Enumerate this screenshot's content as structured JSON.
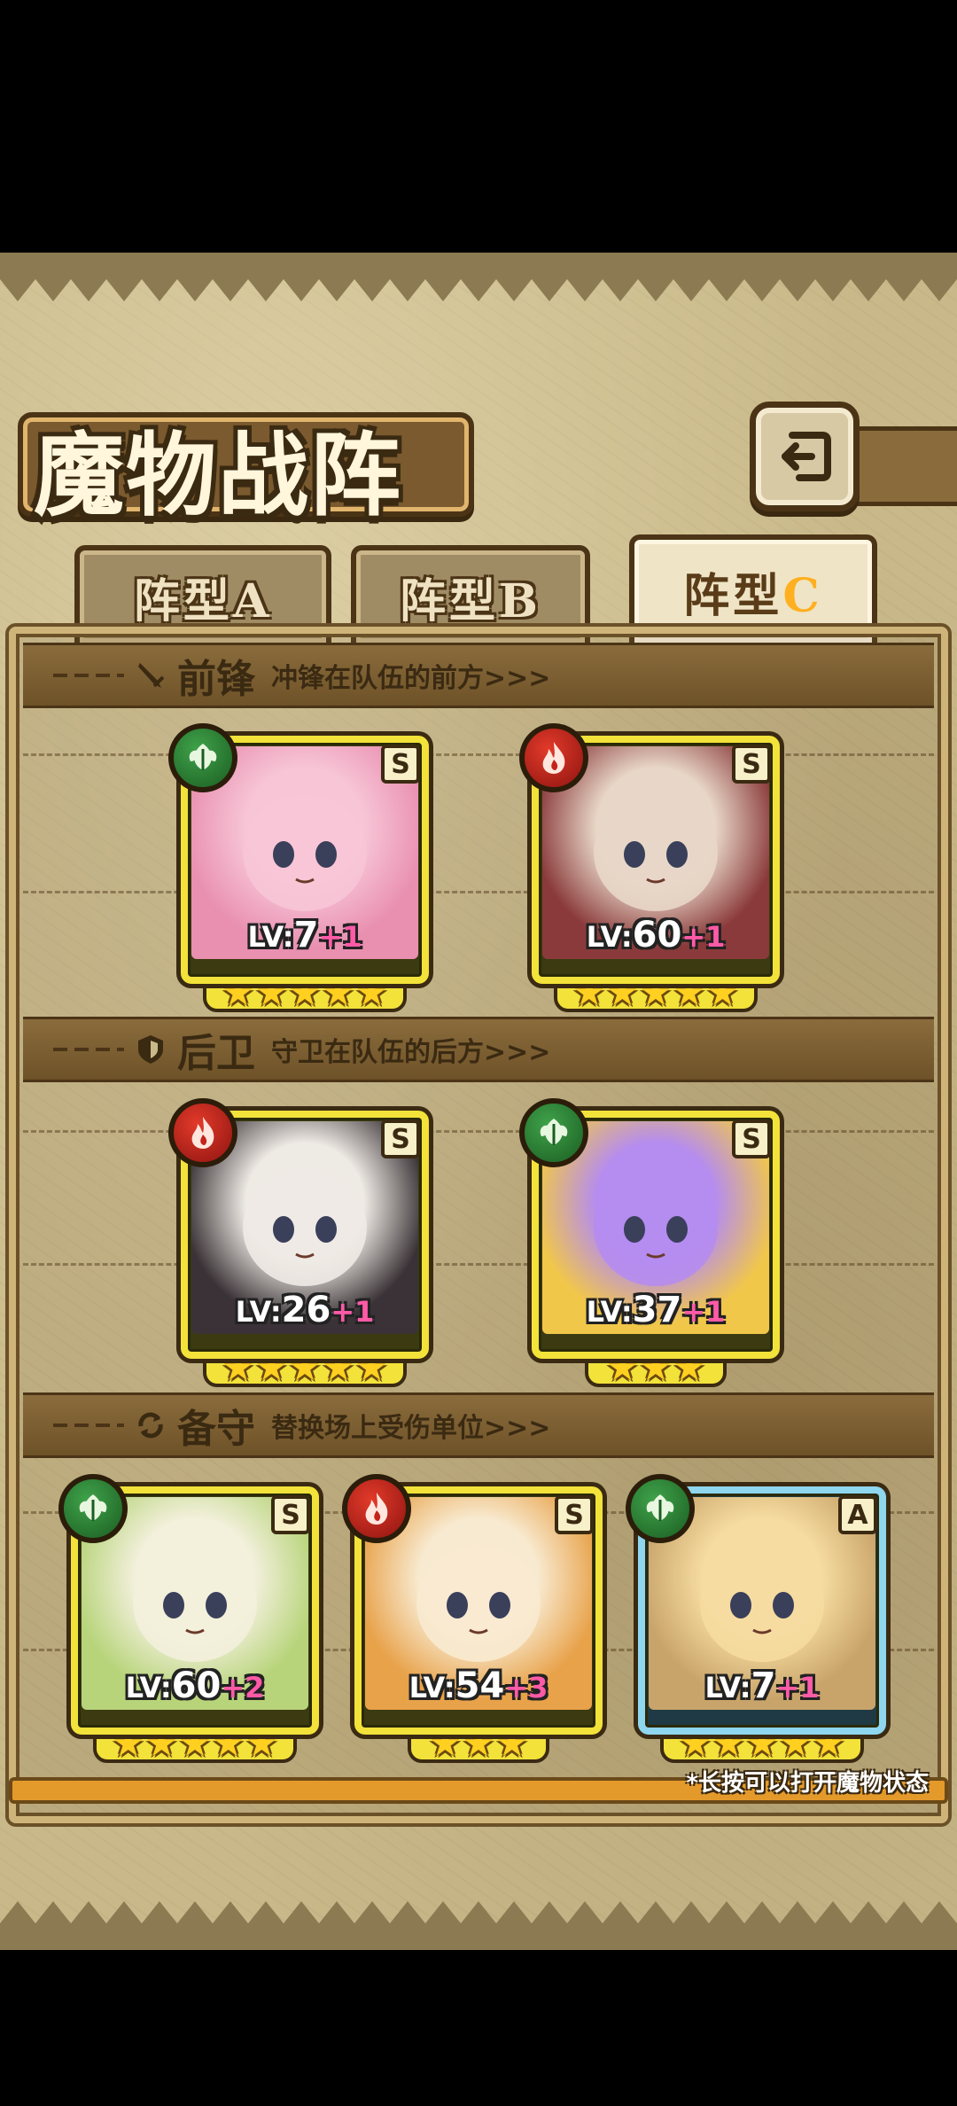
{
  "title": "魔物战阵",
  "back_icon": "return-arrow-icon",
  "tabs": [
    {
      "label": "阵型",
      "letter": "A",
      "active": false
    },
    {
      "label": "阵型",
      "letter": "B",
      "active": false
    },
    {
      "label": "阵型",
      "letter": "C",
      "active": true
    }
  ],
  "sections": {
    "front": {
      "icon": "sword-icon",
      "title": "前锋",
      "desc": "冲锋在队伍的前方>>>"
    },
    "rear": {
      "icon": "shield-icon",
      "title": "后卫",
      "desc": "守卫在队伍的后方>>>"
    },
    "reserve": {
      "icon": "swap-arrows-icon",
      "title": "备守",
      "desc": "替换场上受伤单位>>>"
    }
  },
  "cards": {
    "front": [
      {
        "element": "nature",
        "rank": "S",
        "lv_label": "LV:",
        "lv": "7",
        "plus": "+1",
        "stars": 5,
        "art_colors": [
          "#f7c5d6",
          "#e98fb0"
        ]
      },
      {
        "element": "fire",
        "rank": "S",
        "lv_label": "LV:",
        "lv": "60",
        "plus": "+1",
        "stars": 5,
        "art_colors": [
          "#e8d7c8",
          "#8a3a3a"
        ]
      }
    ],
    "rear": [
      {
        "element": "fire",
        "rank": "S",
        "lv_label": "LV:",
        "lv": "26",
        "plus": "+1",
        "stars": 5,
        "art_colors": [
          "#eeeae4",
          "#3a3236"
        ]
      },
      {
        "element": "nature",
        "rank": "S",
        "lv_label": "LV:",
        "lv": "37",
        "plus": "+1",
        "stars": 3,
        "art_colors": [
          "#b58cf0",
          "#f1c74a"
        ]
      }
    ],
    "reserve": [
      {
        "element": "nature",
        "rank": "S",
        "lv_label": "LV:",
        "lv": "60",
        "plus": "+2",
        "stars": 5,
        "art_colors": [
          "#f3f0dc",
          "#b7d47a"
        ]
      },
      {
        "element": "fire",
        "rank": "S",
        "lv_label": "LV:",
        "lv": "54",
        "plus": "+3",
        "stars": 3,
        "art_colors": [
          "#f8ead0",
          "#e8a24a"
        ]
      },
      {
        "element": "nature",
        "rank": "A",
        "lv_label": "LV:",
        "lv": "7",
        "plus": "+1",
        "stars": 5,
        "art_colors": [
          "#f6dca0",
          "#c9a46a"
        ]
      }
    ]
  },
  "footnote": "*长按可以打开魔物状态",
  "colors": {
    "frame_s": "#f2e23a",
    "frame_a": "#8fd6ef",
    "accent": "#e49a2a",
    "plus": "#ff5aa8"
  }
}
